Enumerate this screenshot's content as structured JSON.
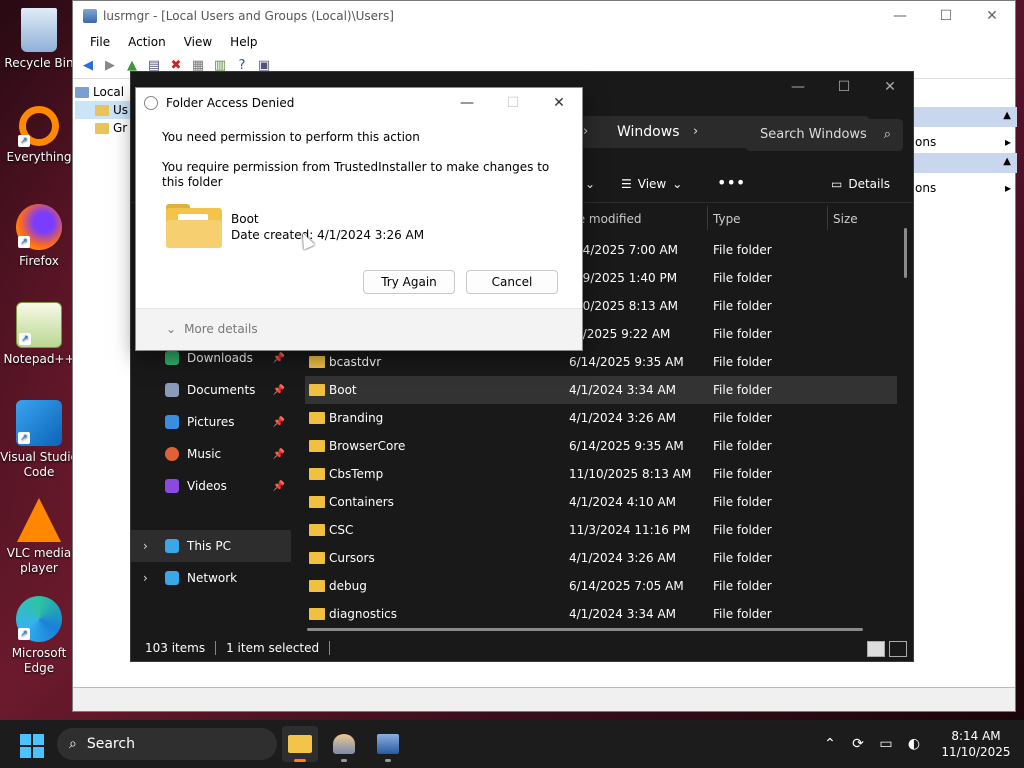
{
  "desktop": {
    "icons": [
      {
        "label": "Recycle Bin"
      },
      {
        "label": "Everything"
      },
      {
        "label": "Firefox"
      },
      {
        "label": "Notepad++"
      },
      {
        "label": "Visual Studio Code"
      },
      {
        "label": "VLC media player"
      },
      {
        "label": "Microsoft Edge"
      }
    ]
  },
  "mmc": {
    "title": "lusrmgr - [Local Users and Groups (Local)\\Users]",
    "menu": [
      "File",
      "Action",
      "View",
      "Help"
    ],
    "tree": [
      "Local",
      "Us",
      "Gr"
    ],
    "actions": [
      "ons",
      "ons"
    ]
  },
  "explorer": {
    "breadcrumb": "Windows",
    "search_placeholder": "Search Windows",
    "view_label": "View",
    "details_label": "Details",
    "columns": {
      "modified": "te modified",
      "type": "Type",
      "size": "Size"
    },
    "upper_rows": [
      {
        "date": "4/4/2025 7:00 AM",
        "type": "File folder"
      },
      {
        "date": "/19/2025 1:40 PM",
        "type": "File folder"
      },
      {
        "date": "/10/2025 8:13 AM",
        "type": "File folder"
      },
      {
        "date": "/8/2025 9:22 AM",
        "type": "File folder"
      }
    ],
    "nav": [
      {
        "label": "Downloads"
      },
      {
        "label": "Documents"
      },
      {
        "label": "Pictures"
      },
      {
        "label": "Music"
      },
      {
        "label": "Videos"
      },
      {
        "label": "This PC"
      },
      {
        "label": "Network"
      }
    ],
    "files": [
      {
        "name": "bcastdvr",
        "date": "6/14/2025 9:35 AM",
        "type": "File folder"
      },
      {
        "name": "Boot",
        "date": "4/1/2024 3:34 AM",
        "type": "File folder"
      },
      {
        "name": "Branding",
        "date": "4/1/2024 3:26 AM",
        "type": "File folder"
      },
      {
        "name": "BrowserCore",
        "date": "6/14/2025 9:35 AM",
        "type": "File folder"
      },
      {
        "name": "CbsTemp",
        "date": "11/10/2025 8:13 AM",
        "type": "File folder"
      },
      {
        "name": "Containers",
        "date": "4/1/2024 4:10 AM",
        "type": "File folder"
      },
      {
        "name": "CSC",
        "date": "11/3/2024 11:16 PM",
        "type": "File folder"
      },
      {
        "name": "Cursors",
        "date": "4/1/2024 3:26 AM",
        "type": "File folder"
      },
      {
        "name": "debug",
        "date": "6/14/2025 7:05 AM",
        "type": "File folder"
      },
      {
        "name": "diagnostics",
        "date": "4/1/2024 3:34 AM",
        "type": "File folder"
      }
    ],
    "status": {
      "count": "103 items",
      "selected": "1 item selected"
    }
  },
  "dialog": {
    "title": "Folder Access Denied",
    "message1": "You need permission to perform this action",
    "message2": "You require permission from TrustedInstaller to make changes to this folder",
    "folder_name": "Boot",
    "date_created": "Date created: 4/1/2024 3:26 AM",
    "try_again": "Try Again",
    "cancel": "Cancel",
    "more_details": "More details"
  },
  "taskbar": {
    "search_label": "Search",
    "time": "8:14 AM",
    "date": "11/10/2025"
  }
}
